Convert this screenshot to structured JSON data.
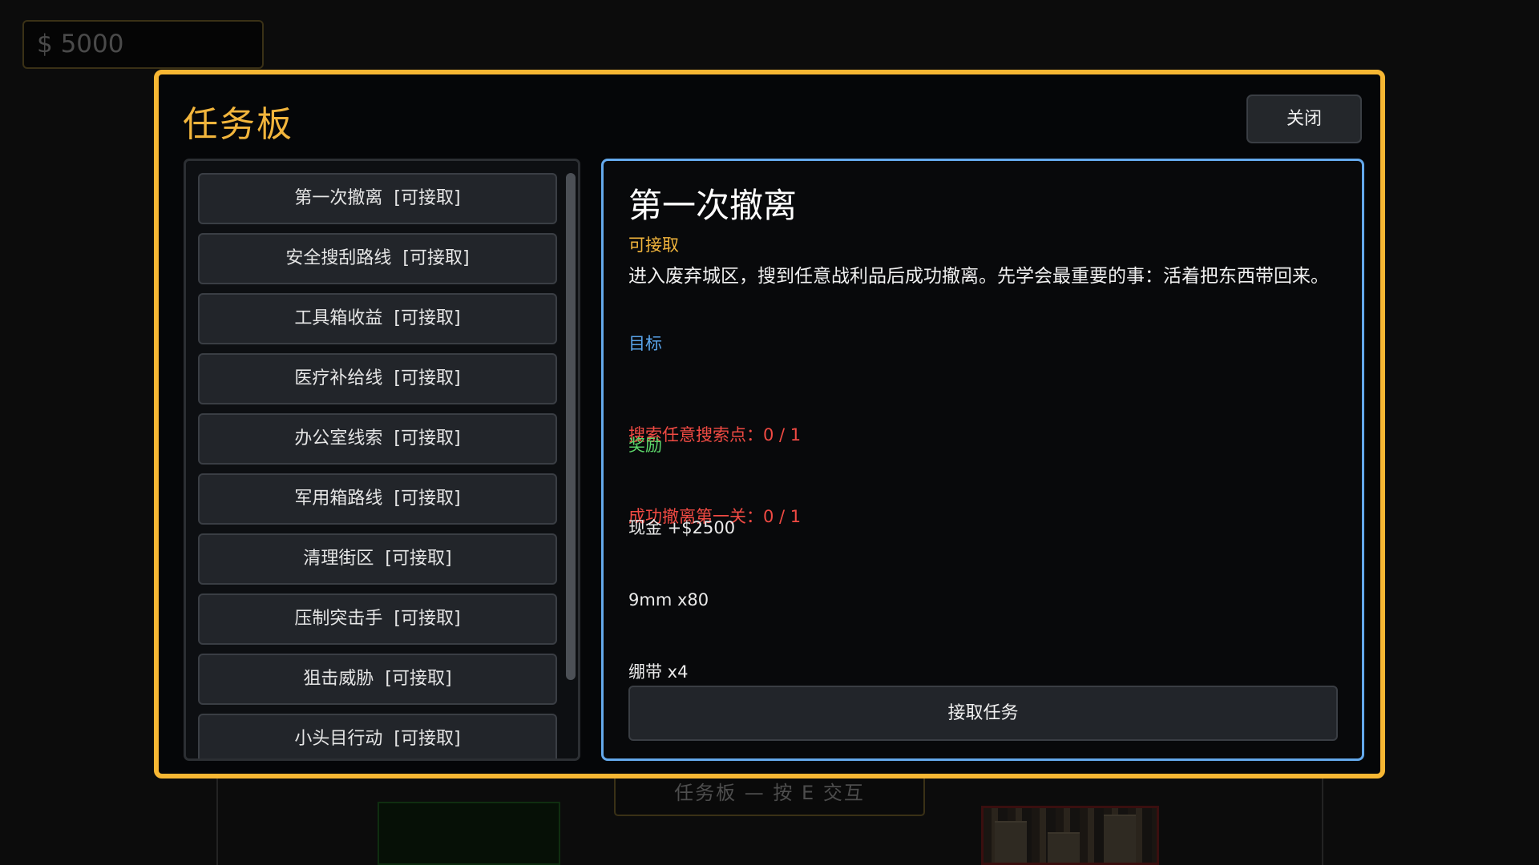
{
  "hud": {
    "money": "$  5000",
    "prompt": "任务板 — 按 E 交互"
  },
  "modal": {
    "title": "任务板",
    "close_label": "关闭"
  },
  "quests": [
    {
      "label": "第一次撤离  [可接取]"
    },
    {
      "label": "安全搜刮路线  [可接取]"
    },
    {
      "label": "工具箱收益  [可接取]"
    },
    {
      "label": "医疗补给线  [可接取]"
    },
    {
      "label": "办公室线索  [可接取]"
    },
    {
      "label": "军用箱路线  [可接取]"
    },
    {
      "label": "清理街区  [可接取]"
    },
    {
      "label": "压制突击手  [可接取]"
    },
    {
      "label": "狙击威胁  [可接取]"
    },
    {
      "label": "小头目行动  [可接取]"
    }
  ],
  "detail": {
    "title": "第一次撤离",
    "status": "可接取",
    "description": "进入废弃城区，搜到任意战利品后成功撤离。先学会最重要的事：活着把东西带回来。",
    "objectives_heading": "目标",
    "objectives": [
      "搜索任意搜索点：0 / 1",
      "成功撤离第一关：0 / 1"
    ],
    "rewards_heading": "奖励",
    "rewards": [
      "现金 +$2500",
      "9mm x80",
      "绷带 x4"
    ],
    "accept_label": "接取任务"
  },
  "colors": {
    "accent": "#f7b733",
    "detail_border": "#64a9ec",
    "objective": "#f04a43",
    "reward_heading": "#5cd66a"
  }
}
